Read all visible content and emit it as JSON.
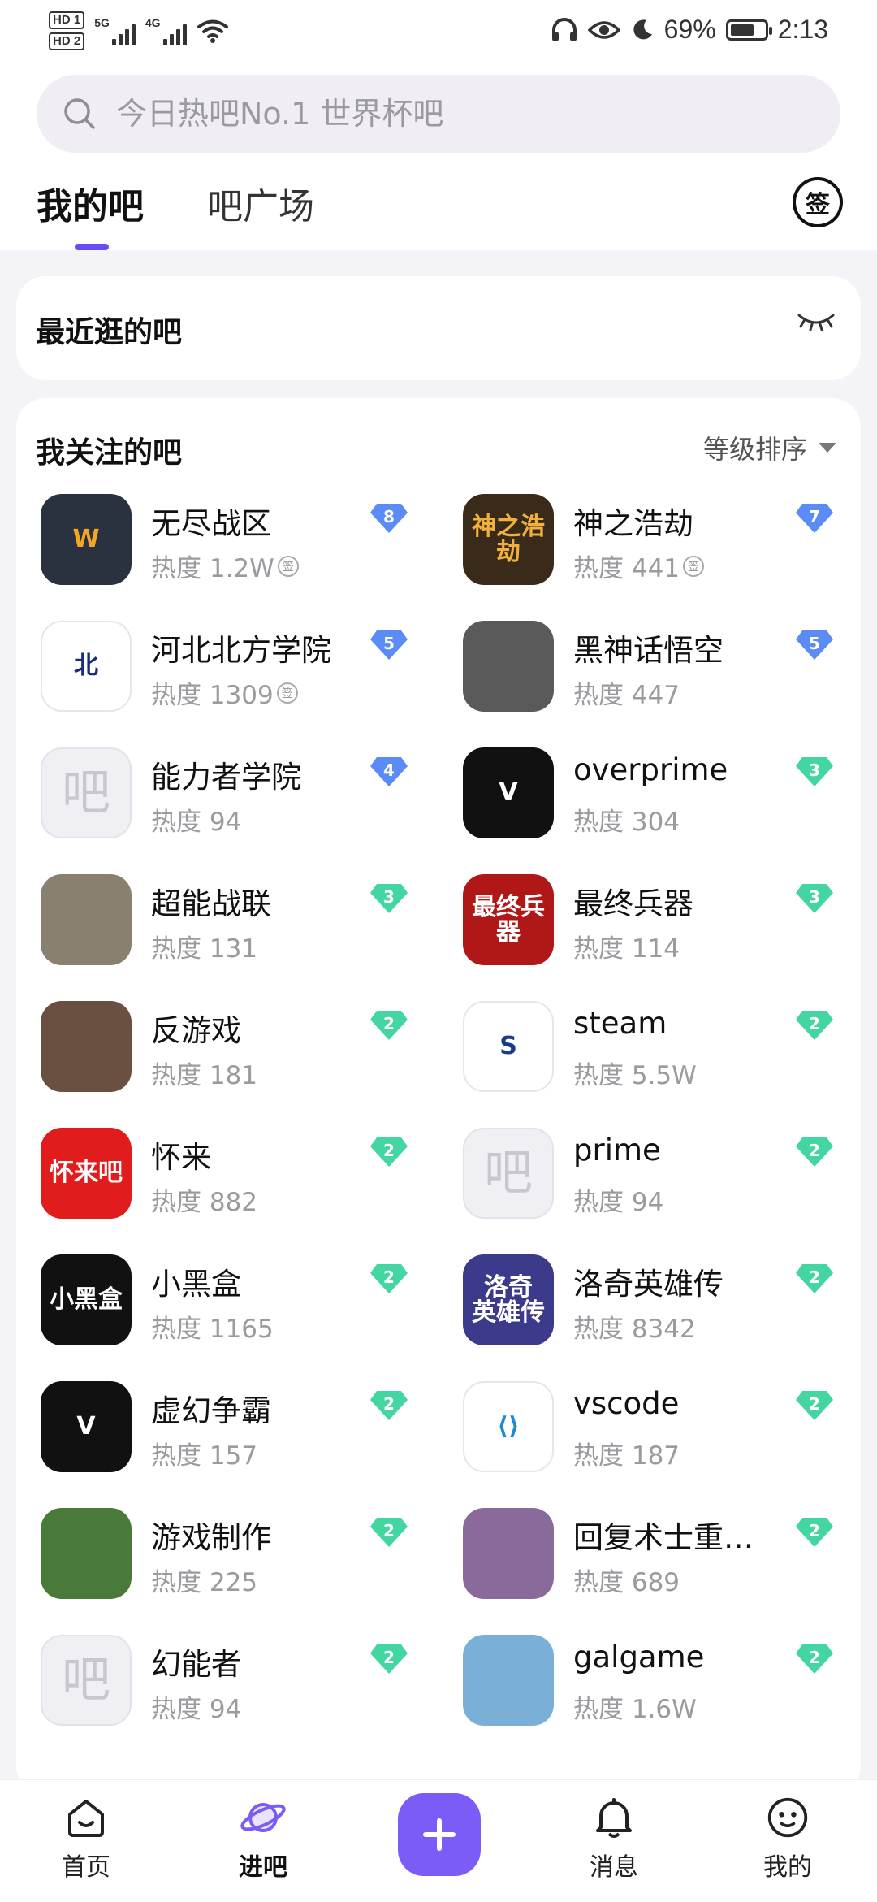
{
  "status_bar": {
    "hd1": "HD 1",
    "hd2": "HD 2",
    "network1": "5G",
    "network2": "4G",
    "battery": "69%",
    "battery_level": 0.69,
    "time": "2:13"
  },
  "search": {
    "placeholder": "今日热吧No.1 世界杯吧"
  },
  "tabs": [
    {
      "label": "我的吧",
      "active": true
    },
    {
      "label": "吧广场",
      "active": false
    }
  ],
  "sign_icon": "签",
  "recent": {
    "title": "最近逛的吧"
  },
  "followed": {
    "title": "我关注的吧",
    "sort_label": "等级排序",
    "forums": [
      {
        "name": "无尽战区",
        "heat": "热度 1.2W",
        "signed": true,
        "level": "8",
        "level_color": "#5b8cf5",
        "avatar_text": "W",
        "avatar_bg": "#2a3240",
        "avatar_fg": "#f5a623"
      },
      {
        "name": "神之浩劫",
        "heat": "热度 441",
        "signed": true,
        "level": "7",
        "level_color": "#5b8cf5",
        "avatar_text": "神之浩劫",
        "avatar_bg": "#3a2a1a",
        "avatar_fg": "#f0b040"
      },
      {
        "name": "河北北方学院",
        "heat": "热度 1309",
        "signed": true,
        "level": "5",
        "level_color": "#5b8cf5",
        "avatar_text": "北",
        "avatar_bg": "#ffffff",
        "avatar_fg": "#1a2a7a"
      },
      {
        "name": "黑神话悟空",
        "heat": "热度 447",
        "signed": false,
        "level": "5",
        "level_color": "#5b8cf5",
        "avatar_text": "",
        "avatar_bg": "#5a5a5a",
        "avatar_fg": "#ffffff"
      },
      {
        "name": "能力者学院",
        "heat": "热度 94",
        "signed": false,
        "level": "4",
        "level_color": "#5b8cf5",
        "avatar_text": "吧",
        "avatar_bg": "placeholder",
        "avatar_fg": "#c8c7d0"
      },
      {
        "name": "overprime",
        "heat": "热度 304",
        "signed": false,
        "level": "3",
        "level_color": "#43d6a0",
        "avatar_text": "V",
        "avatar_bg": "#111111",
        "avatar_fg": "#ffffff"
      },
      {
        "name": "超能战联",
        "heat": "热度 131",
        "signed": false,
        "level": "3",
        "level_color": "#43d6a0",
        "avatar_text": "",
        "avatar_bg": "#8a8070",
        "avatar_fg": "#ffffff"
      },
      {
        "name": "最终兵器",
        "heat": "热度 114",
        "signed": false,
        "level": "3",
        "level_color": "#43d6a0",
        "avatar_text": "最终兵器",
        "avatar_bg": "#b01818",
        "avatar_fg": "#ffffff"
      },
      {
        "name": "反游戏",
        "heat": "热度 181",
        "signed": false,
        "level": "2",
        "level_color": "#43d6a0",
        "avatar_text": "",
        "avatar_bg": "#6a5040",
        "avatar_fg": "#ffffff"
      },
      {
        "name": "steam",
        "heat": "热度 5.5W",
        "signed": false,
        "level": "2",
        "level_color": "#43d6a0",
        "avatar_text": "S",
        "avatar_bg": "#ffffff",
        "avatar_fg": "#1a3a8a"
      },
      {
        "name": "怀来",
        "heat": "热度 882",
        "signed": false,
        "level": "2",
        "level_color": "#43d6a0",
        "avatar_text": "怀来吧",
        "avatar_bg": "#e01c1c",
        "avatar_fg": "#ffffff"
      },
      {
        "name": "prime",
        "heat": "热度 94",
        "signed": false,
        "level": "2",
        "level_color": "#43d6a0",
        "avatar_text": "吧",
        "avatar_bg": "placeholder",
        "avatar_fg": "#c8c7d0"
      },
      {
        "name": "小黑盒",
        "heat": "热度 1165",
        "signed": false,
        "level": "2",
        "level_color": "#43d6a0",
        "avatar_text": "小黑盒",
        "avatar_bg": "#111111",
        "avatar_fg": "#ffffff"
      },
      {
        "name": "洛奇英雄传",
        "heat": "热度 8342",
        "signed": false,
        "level": "2",
        "level_color": "#43d6a0",
        "avatar_text": "洛奇\n英雄传",
        "avatar_bg": "#3c3a8a",
        "avatar_fg": "#ffffff"
      },
      {
        "name": "虚幻争霸",
        "heat": "热度 157",
        "signed": false,
        "level": "2",
        "level_color": "#43d6a0",
        "avatar_text": "V",
        "avatar_bg": "#111111",
        "avatar_fg": "#ffffff"
      },
      {
        "name": "vscode",
        "heat": "热度 187",
        "signed": false,
        "level": "2",
        "level_color": "#43d6a0",
        "avatar_text": "⟨⟩",
        "avatar_bg": "#ffffff",
        "avatar_fg": "#1f8ad2"
      },
      {
        "name": "游戏制作",
        "heat": "热度 225",
        "signed": false,
        "level": "2",
        "level_color": "#43d6a0",
        "avatar_text": "",
        "avatar_bg": "#4a7a3a",
        "avatar_fg": "#ffffff"
      },
      {
        "name": "回复术士重…",
        "heat": "热度 689",
        "signed": false,
        "level": "2",
        "level_color": "#43d6a0",
        "avatar_text": "",
        "avatar_bg": "#8a6a9a",
        "avatar_fg": "#ffffff"
      },
      {
        "name": "幻能者",
        "heat": "热度 94",
        "signed": false,
        "level": "2",
        "level_color": "#43d6a0",
        "avatar_text": "吧",
        "avatar_bg": "placeholder",
        "avatar_fg": "#c8c7d0"
      },
      {
        "name": "galgame",
        "heat": "热度 1.6W",
        "signed": false,
        "level": "2",
        "level_color": "#43d6a0",
        "avatar_text": "",
        "avatar_bg": "#7ab0d8",
        "avatar_fg": "#ffffff"
      }
    ]
  },
  "bottom_nav": [
    {
      "label": "首页",
      "icon": "home-icon",
      "active": false
    },
    {
      "label": "进吧",
      "icon": "forum-planet-icon",
      "active": true
    },
    {
      "label": "消息",
      "icon": "bell-icon",
      "active": false
    },
    {
      "label": "我的",
      "icon": "smile-face-icon",
      "active": false
    }
  ],
  "colors": {
    "accent": "#7c5cf6",
    "tab_indicator": "#6a4bf5",
    "level_blue": "#5b8cf5",
    "level_green": "#43d6a0"
  }
}
